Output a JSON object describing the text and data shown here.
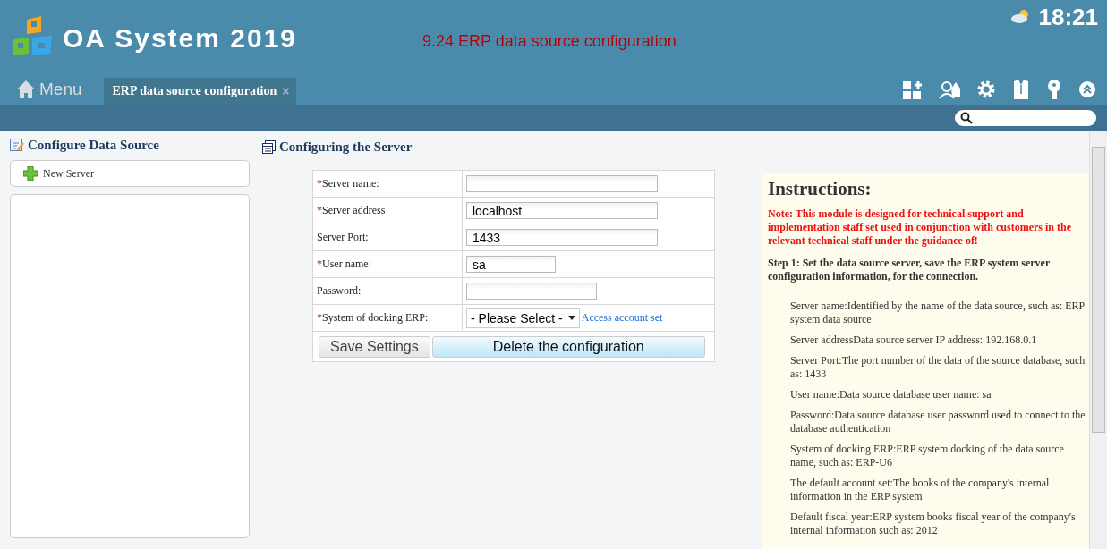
{
  "header": {
    "title": "OA System 2019",
    "notice": "9.24 ERP data source configuration",
    "time": "18:21"
  },
  "nav": {
    "menu": "Menu",
    "tabs": [
      {
        "label": "ERP data source configuration",
        "selected": true,
        "close": "×"
      }
    ]
  },
  "sidebar": {
    "title": "Configure Data Source",
    "new_button": "New Server"
  },
  "form": {
    "title": "Configuring the Server",
    "fields": [
      {
        "required_mark": "*",
        "label": "Server name:",
        "kind": "wide"
      },
      {
        "required_mark": "*",
        "label": "Server address",
        "kind": "wide",
        "value": "localhost"
      },
      {
        "label": "Server Port:",
        "kind": "wide",
        "value": "1433"
      },
      {
        "required_mark": "*",
        "label": "User name:",
        "kind": "short",
        "value": "sa"
      },
      {
        "label": "Password:",
        "kind": "medium"
      },
      {
        "required_mark": "*",
        "label": "System of docking ERP:",
        "kind": "select",
        "value": "- Please Select -",
        "link": "Access account set"
      }
    ],
    "buttons": [
      {
        "label": "Save Settings",
        "primary": false
      },
      {
        "label": "Delete the configuration",
        "primary": true
      }
    ]
  },
  "instructions": {
    "title": "Instructions:",
    "note": "Note: This module is designed for technical support and implementation staff set used in conjunction with customers in the relevant technical staff under the guidance of!",
    "step": "Step 1: Set the data source server, save the ERP system server configuration information, for the connection.",
    "items": [
      "Server name:Identified by the name of the data source, such as: ERP system data source",
      "Server addressData source server IP address: 192.168.0.1",
      "Server Port:The port number of the data of the source database, such as: 1433",
      "User name:Data source database user name: sa",
      "Password:Data source database user password used to connect to the database authentication",
      "System of docking ERP:ERP system docking of the data source name, such as: ERP-U6",
      "The default account set:The books of the company's internal information in the ERP system",
      "Default fiscal year:ERP system books fiscal year of the company's internal information such as: 2012"
    ]
  }
}
